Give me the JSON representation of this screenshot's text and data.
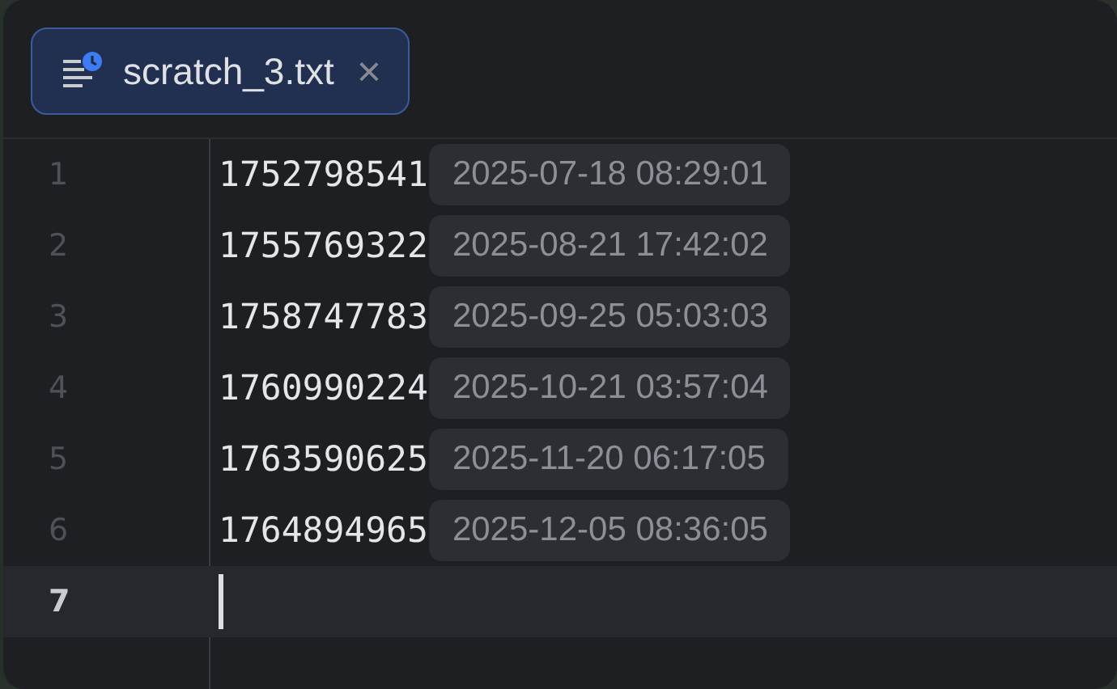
{
  "tabs": [
    {
      "label": "scratch_3.txt",
      "selected": true,
      "close": "×"
    }
  ],
  "editor": {
    "lines": [
      {
        "number": "1",
        "text": "1752798541",
        "hint": "2025-07-18 08:29:01",
        "current": false
      },
      {
        "number": "2",
        "text": "1755769322",
        "hint": "2025-08-21 17:42:02",
        "current": false
      },
      {
        "number": "3",
        "text": "1758747783",
        "hint": "2025-09-25 05:03:03",
        "current": false
      },
      {
        "number": "4",
        "text": "1760990224",
        "hint": "2025-10-21 03:57:04",
        "current": false
      },
      {
        "number": "5",
        "text": "1763590625",
        "hint": "2025-11-20 06:17:05",
        "current": false
      },
      {
        "number": "6",
        "text": "1764894965",
        "hint": "2025-12-05 08:36:05",
        "current": false
      },
      {
        "number": "7",
        "current": true
      }
    ]
  }
}
